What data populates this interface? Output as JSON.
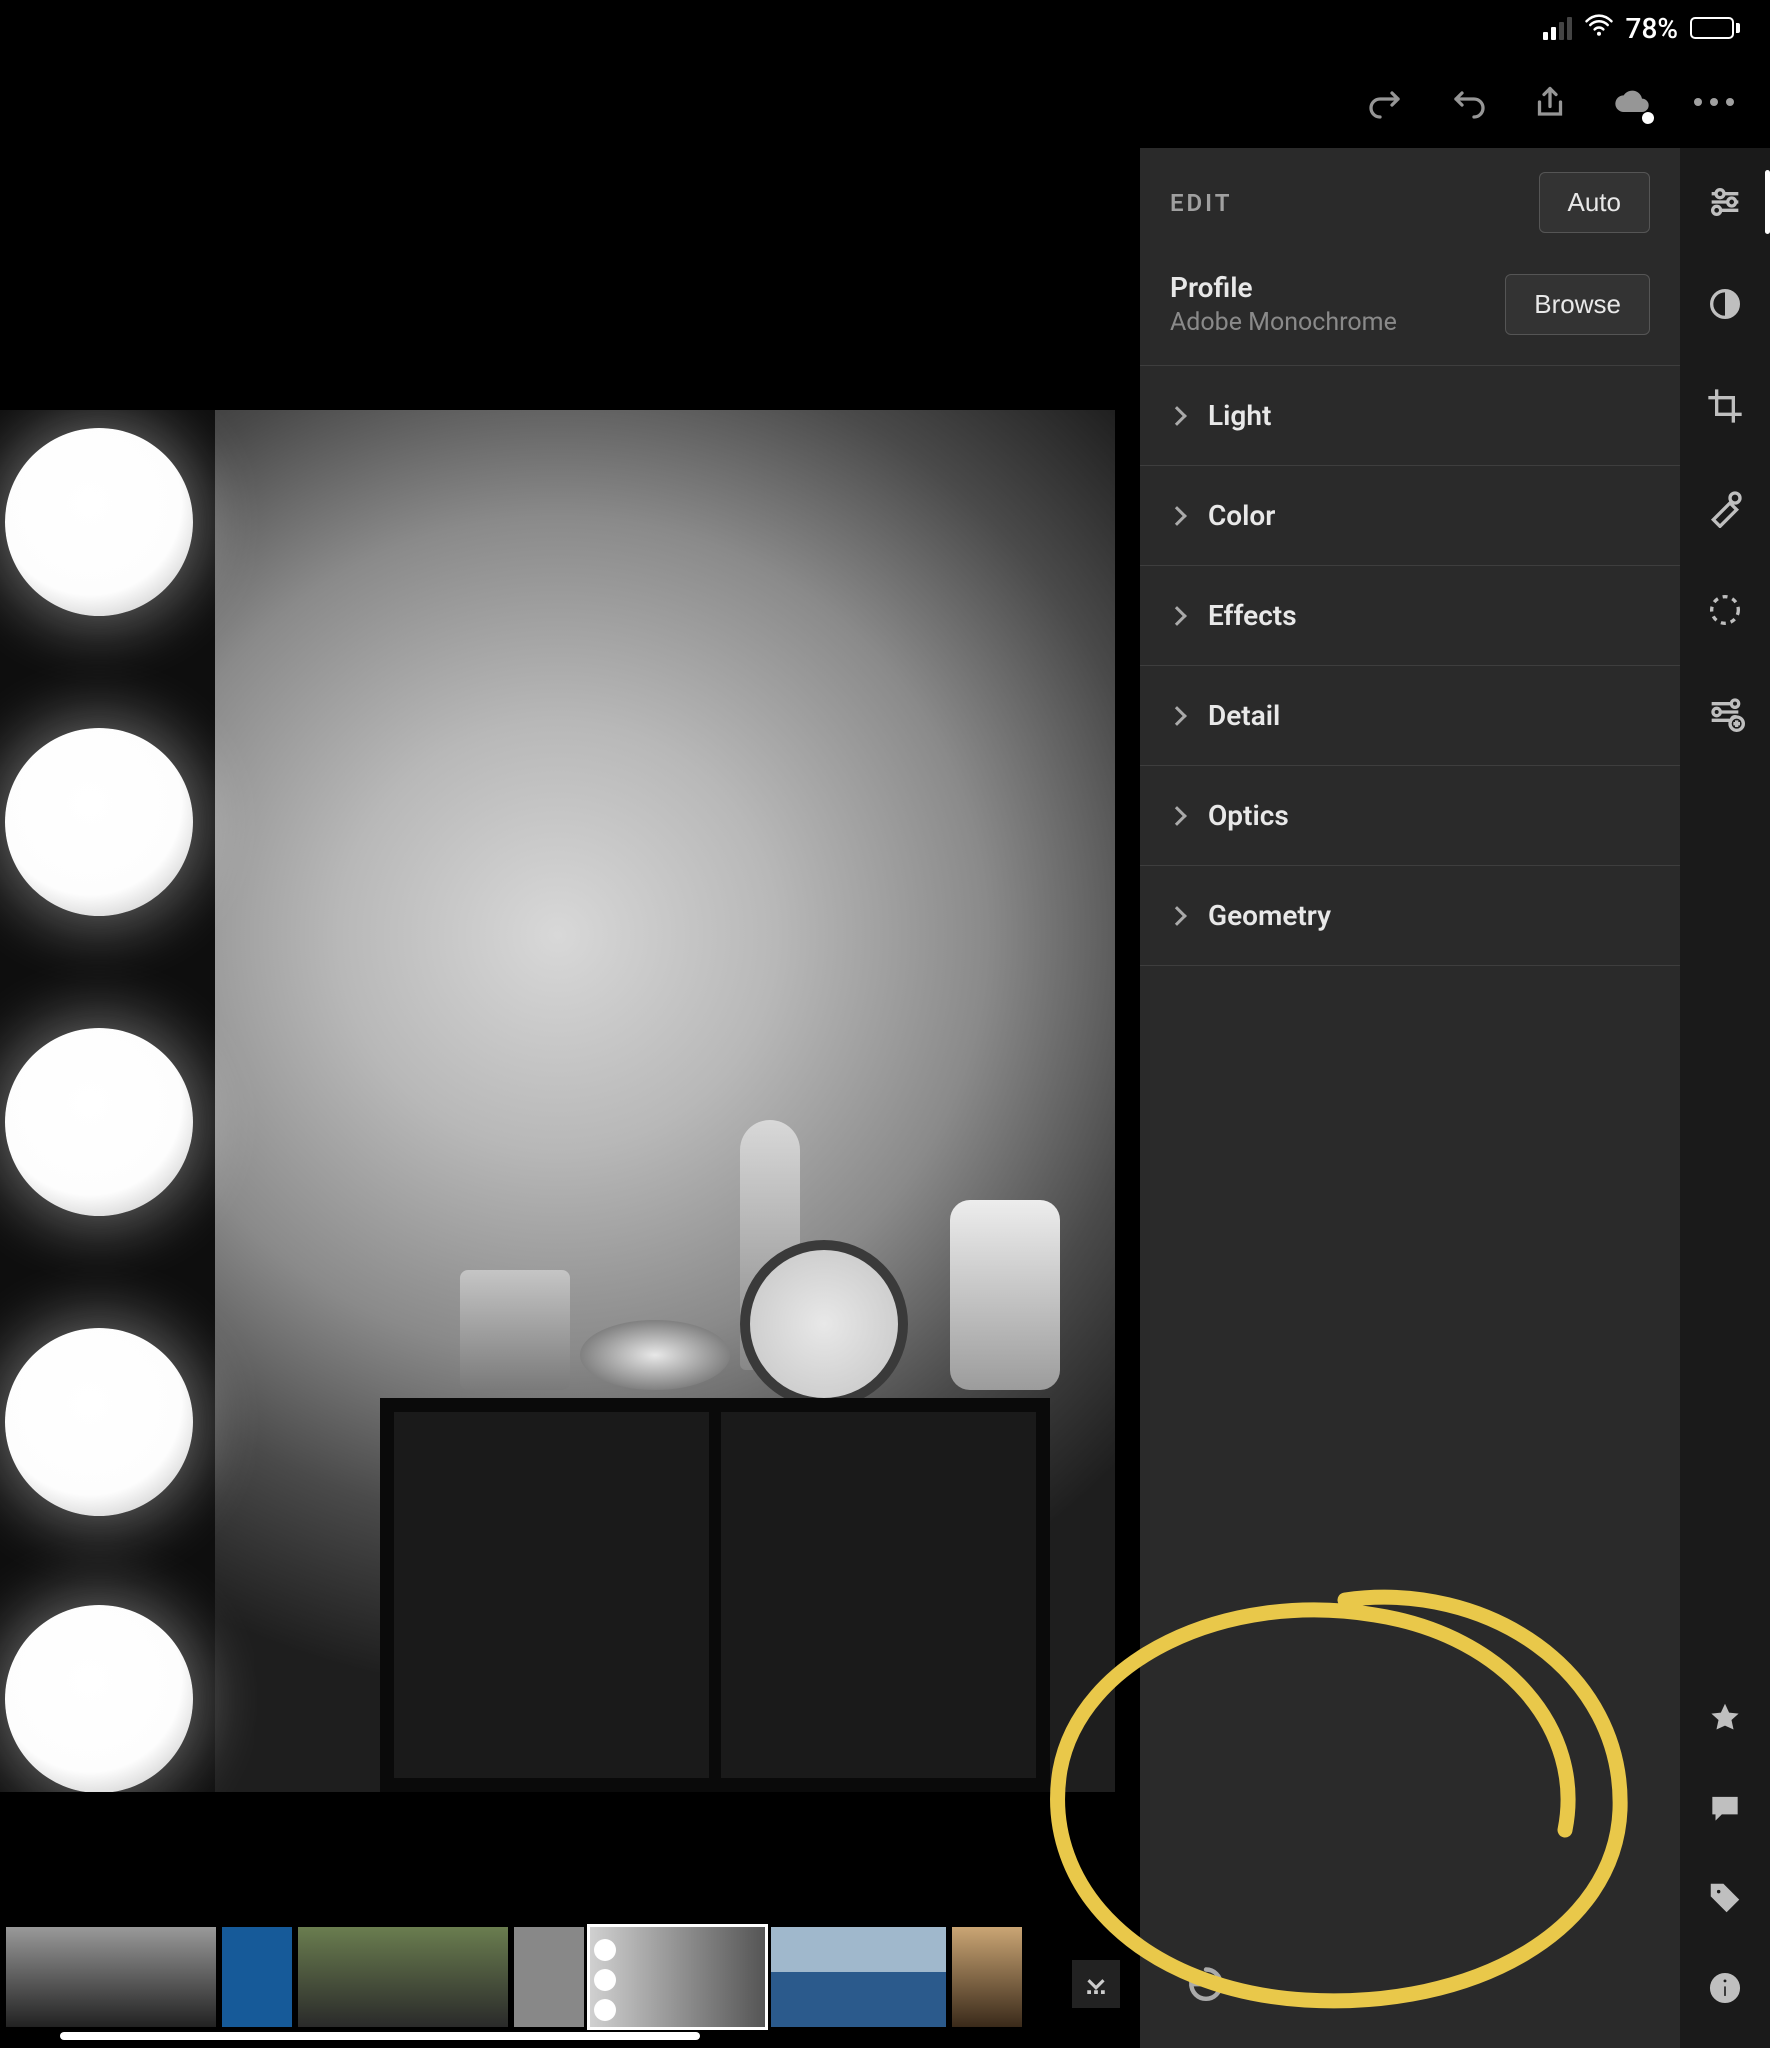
{
  "status_bar": {
    "battery_pct": "78%"
  },
  "top_toolbar": {
    "redo": "redo",
    "undo": "undo",
    "share": "share",
    "cloud": "cloud-sync",
    "more": "more"
  },
  "edit_panel": {
    "title": "EDIT",
    "auto_button": "Auto",
    "profile_label": "Profile",
    "profile_value": "Adobe Monochrome",
    "browse_button": "Browse",
    "sections": [
      {
        "label": "Light"
      },
      {
        "label": "Color"
      },
      {
        "label": "Effects"
      },
      {
        "label": "Detail"
      },
      {
        "label": "Optics"
      },
      {
        "label": "Geometry"
      }
    ],
    "reset_icon": "reset"
  },
  "right_rail": {
    "top_tools": [
      {
        "name": "edit-sliders-icon",
        "active": true
      },
      {
        "name": "presets-icon"
      },
      {
        "name": "crop-icon"
      },
      {
        "name": "healing-brush-icon"
      },
      {
        "name": "masking-icon"
      },
      {
        "name": "versions-icon"
      }
    ],
    "bottom_tools": [
      {
        "name": "rate-star-icon"
      },
      {
        "name": "comments-icon"
      },
      {
        "name": "keywords-tag-icon"
      },
      {
        "name": "info-icon"
      }
    ]
  },
  "filmstrip": {
    "selected_index": 4,
    "thumbnails": 7
  },
  "photo": {
    "description": "Black-and-white monochrome photo of a vanity mirror with round bulbs on the left, blurry dresser top with a statuette, alarm clock and objects on a dark shelf."
  },
  "annotation": {
    "shape": "hand-drawn-circle",
    "color": "#e9c84a"
  }
}
